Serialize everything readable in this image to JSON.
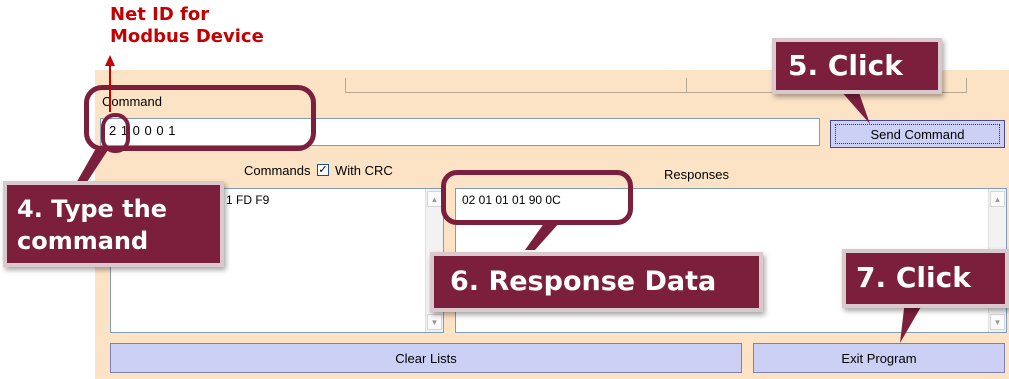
{
  "form": {
    "command_label": "Command",
    "command_value": "2 1 0 0 0 1",
    "send_button": "Send Command",
    "commands_label": "Commands",
    "with_crc_label": "With CRC",
    "with_crc_checked": true,
    "responses_label": "Responses",
    "commands_list": [
      "1 FD F9"
    ],
    "responses_list": [
      "02 01 01 01 90 0C"
    ],
    "clear_button": "Clear Lists",
    "exit_button": "Exit Program"
  },
  "annotations": {
    "net_id_line1": "Net ID for",
    "net_id_line2": "Modbus Device",
    "step4_line1": "4. Type the",
    "step4_line2": "command",
    "step5": "5. Click",
    "step6": "6. Response Data",
    "step7": "7. Click"
  },
  "colors": {
    "panel": "#fde3c6",
    "button": "#cbd0f4",
    "callout": "#7b1f3d",
    "note": "#c40000"
  }
}
